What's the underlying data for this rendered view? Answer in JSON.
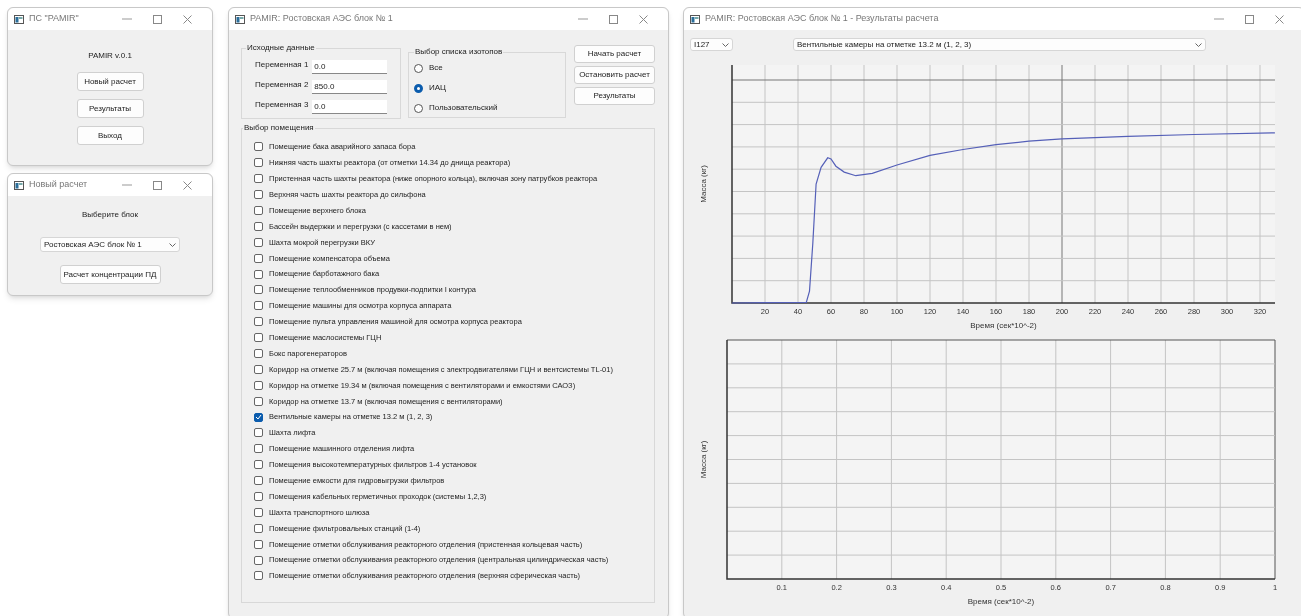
{
  "main_window": {
    "title": "ПС \"PAMIR\"",
    "version": "PAMIR v.0.1",
    "buttons": [
      "Новый расчет",
      "Результаты",
      "Выход"
    ]
  },
  "new_calc_window": {
    "title": "Новый расчет",
    "prompt": "Выберите блок",
    "block_select": {
      "value": "Ростовская АЭС блок № 1"
    },
    "button": "Расчет концентрации ПД"
  },
  "project_window": {
    "title": "PAMIR: Ростовская АЭС блок № 1",
    "input_group": {
      "title": "Исходные данные",
      "fields": [
        {
          "label": "Переменная 1",
          "value": "0.0"
        },
        {
          "label": "Переменная 2",
          "value": "850.0"
        },
        {
          "label": "Переменная 3",
          "value": "0.0"
        }
      ]
    },
    "isotope_group": {
      "title": "Выбор списка изотопов",
      "options": [
        {
          "label": "Все",
          "selected": false
        },
        {
          "label": "ИАЦ",
          "selected": true
        },
        {
          "label": "Пользовательский",
          "selected": false
        }
      ]
    },
    "buttons": [
      "Начать расчет",
      "Остановить расчет",
      "Результаты"
    ],
    "rooms_group": {
      "title": "Выбор помещения",
      "rooms": [
        {
          "label": "Помещение бака аварийного запаса бора",
          "checked": false
        },
        {
          "label": "Нижняя часть шахты реактора (от отметки 14.34 до днища реактора)",
          "checked": false
        },
        {
          "label": "Пристенная часть шахты реактора (ниже опорного кольца), включая зону патрубков реактора",
          "checked": false
        },
        {
          "label": "Верхняя часть шахты реактора до сильфона",
          "checked": false
        },
        {
          "label": "Помещение верхнего блока",
          "checked": false
        },
        {
          "label": "Бассейн выдержки и перегрузки (с кассетами в нем)",
          "checked": false
        },
        {
          "label": "Шахта мокрой перегрузки ВКУ",
          "checked": false
        },
        {
          "label": "Помещение компенсатора объема",
          "checked": false
        },
        {
          "label": "Помещение барботажного бака",
          "checked": false
        },
        {
          "label": "Помещение теплообменников продувки-подпитки I контура",
          "checked": false
        },
        {
          "label": "Помещение машины для осмотра корпуса аппарата",
          "checked": false
        },
        {
          "label": "Помещение пульта управления машиной для осмотра корпуса реактора",
          "checked": false
        },
        {
          "label": "Помещение маслосистемы ГЦН",
          "checked": false
        },
        {
          "label": "Бокс парогенераторов",
          "checked": false
        },
        {
          "label": "Коридор на отметке 25.7 м (включая помещения с электродвигателями ГЦН и вентсистемы TL-01)",
          "checked": false
        },
        {
          "label": "Коридор на отметке 19.34 м (включая помещения с вентиляторами и емкостями САОЗ)",
          "checked": false
        },
        {
          "label": "Коридор на отметке 13.7 м (включая помещения с вентиляторами)",
          "checked": false
        },
        {
          "label": "Вентильные камеры на отметке 13.2 м (1, 2, 3)",
          "checked": true
        },
        {
          "label": "Шахта лифта",
          "checked": false
        },
        {
          "label": "Помещение машинного отделения лифта",
          "checked": false
        },
        {
          "label": "Помещения высокотемпературных фильтров 1-4 установок",
          "checked": false
        },
        {
          "label": "Помещение емкости для гидровыгрузки фильтров",
          "checked": false
        },
        {
          "label": "Помещения кабельных герметичных проходок (системы 1,2,3)",
          "checked": false
        },
        {
          "label": "Шахта транспортного шлюза",
          "checked": false
        },
        {
          "label": "Помещение фильтровальных станций (1-4)",
          "checked": false
        },
        {
          "label": "Помещение отметки обслуживания реакторного отделения (пристенная кольцевая часть)",
          "checked": false
        },
        {
          "label": "Помещение отметки обслуживания реакторного отделения (центральная цилиндрическая часть)",
          "checked": false
        },
        {
          "label": "Помещение отметки обслуживания реакторного отделения (верхняя сферическая часть)",
          "checked": false
        }
      ]
    }
  },
  "results_window": {
    "title": "PAMIR: Ростовская АЭС блок № 1 - Результаты расчета",
    "isotope_select": {
      "value": "I127"
    },
    "room_select": {
      "value": "Вентильные камеры на отметке 13.2 м (1, 2, 3)"
    },
    "charts": [
      {
        "kind": "curve",
        "ylabel": "Масса (кг)",
        "xlabel": "Время (сек*10^-2)",
        "x_tick_labels": [
          "20",
          "40",
          "60",
          "80",
          "100",
          "120",
          "140",
          "160",
          "180",
          "200",
          "220",
          "240",
          "260",
          "280",
          "300",
          "320"
        ]
      },
      {
        "kind": "empty",
        "ylabel": "Масса (кг)",
        "xlabel": "Время (сек*10^-2)",
        "x_tick_labels": [
          "0.1",
          "0.2",
          "0.3",
          "0.4",
          "0.5",
          "0.6",
          "0.7",
          "0.8",
          "0.9",
          "1"
        ]
      }
    ]
  }
}
